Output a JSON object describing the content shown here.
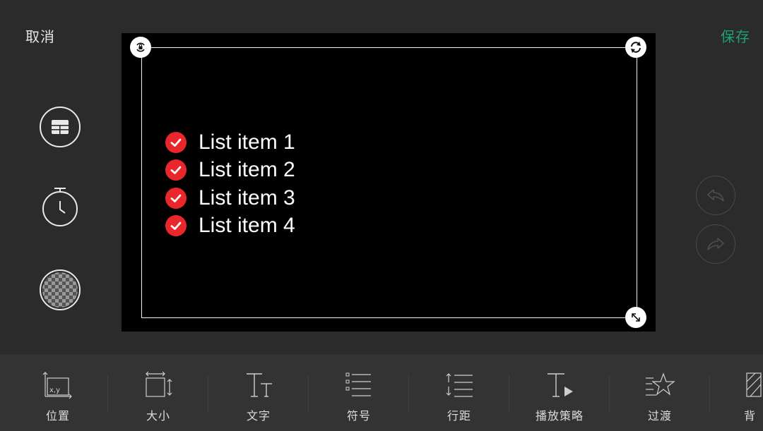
{
  "header": {
    "cancel_label": "取消",
    "save_label": "保存"
  },
  "canvas": {
    "list_items": [
      "List item 1",
      "List item 2",
      "List item 3",
      "List item 4"
    ]
  },
  "sidebar": {
    "icons": [
      "layout-icon",
      "timer-icon",
      "transparency-icon"
    ]
  },
  "history": {
    "undo_icon": "undo-icon",
    "redo_icon": "redo-icon"
  },
  "toolbar": {
    "items": [
      {
        "label": "位置",
        "icon": "position-icon"
      },
      {
        "label": "大小",
        "icon": "size-icon"
      },
      {
        "label": "文字",
        "icon": "text-icon"
      },
      {
        "label": "符号",
        "icon": "bullet-list-icon"
      },
      {
        "label": "行距",
        "icon": "line-spacing-icon"
      },
      {
        "label": "播放策略",
        "icon": "play-strategy-icon"
      },
      {
        "label": "过渡",
        "icon": "transition-star-icon"
      },
      {
        "label": "背",
        "icon": "background-icon"
      }
    ]
  },
  "colors": {
    "accent": "#1aa37a",
    "check": "#e8262c",
    "background": "#2b2b2b",
    "toolbar": "#333333"
  }
}
